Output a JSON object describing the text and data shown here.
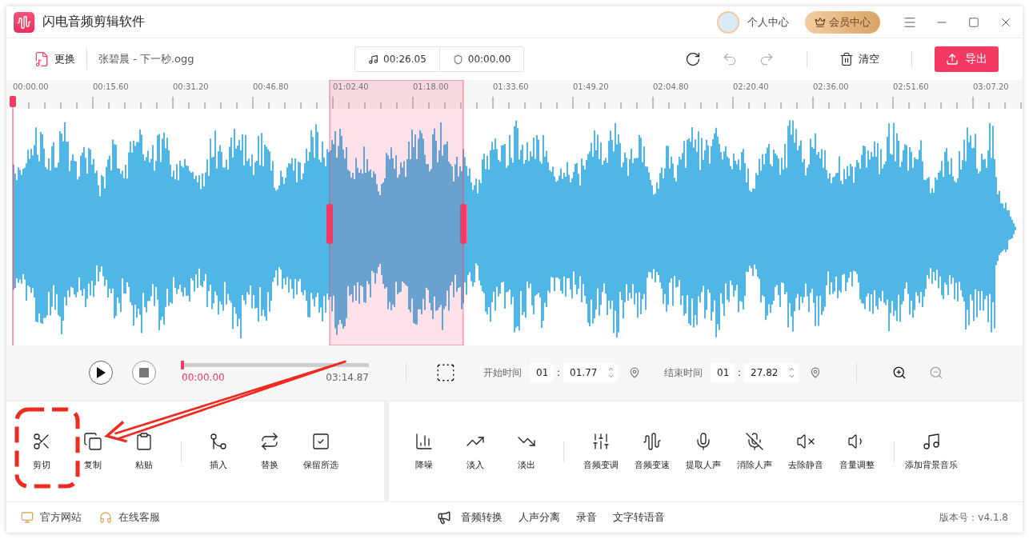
{
  "window": {
    "title": "闪电音频剪辑软件",
    "account": "个人中心",
    "vip": "会员中心"
  },
  "toolbar": {
    "replace": "更换",
    "file_name": "张碧晨 - 下一秒.ogg",
    "selection_length": "00:26.05",
    "cursor_time": "00:00.00",
    "clear": "清空",
    "export": "导出"
  },
  "ruler": {
    "labels": [
      "00:00.00",
      "00:15.60",
      "00:31.20",
      "00:46.80",
      "01:02.40",
      "01:18.00",
      "01:33.60",
      "01:49.20",
      "02:04.80",
      "02:20.40",
      "02:36.00",
      "02:51.60",
      "03:07.20"
    ]
  },
  "player": {
    "progress": {
      "level": 0
    },
    "current": "00:00.00",
    "duration": "03:14.87"
  },
  "range": {
    "start_label": "开始时间",
    "start_min": "01",
    "start_sec": "01.77",
    "end_label": "结束时间",
    "end_min": "01",
    "end_sec": "27.82",
    "separator": ":"
  },
  "tools": {
    "left": [
      [
        "剪切",
        "复制",
        "粘贴"
      ],
      [
        "插入",
        "替换",
        "保留所选"
      ]
    ],
    "right": [
      [
        "降噪",
        "淡入",
        "淡出"
      ],
      [
        "音频变调",
        "音频变速",
        "提取人声",
        "消除人声",
        "去除静音",
        "音量调整"
      ],
      [
        "添加背景音乐"
      ]
    ]
  },
  "footer": {
    "links": [
      "官方网站",
      "在线客服"
    ],
    "features": [
      "音频转换",
      "人声分离",
      "录音",
      "文字转语音"
    ],
    "version": "版本号：v4.1.8"
  }
}
